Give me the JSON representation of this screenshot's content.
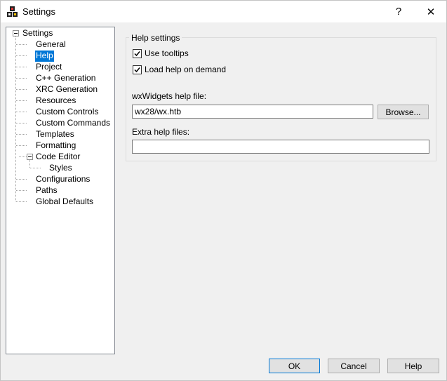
{
  "window": {
    "title": "Settings",
    "help_glyph": "?",
    "close_glyph": "✕"
  },
  "tree": {
    "items": [
      {
        "label": "Settings"
      },
      {
        "label": "General"
      },
      {
        "label": "Help",
        "selected": true
      },
      {
        "label": "Project"
      },
      {
        "label": "C++ Generation"
      },
      {
        "label": "XRC Generation"
      },
      {
        "label": "Resources"
      },
      {
        "label": "Custom Controls"
      },
      {
        "label": "Custom Commands"
      },
      {
        "label": "Templates"
      },
      {
        "label": "Formatting"
      },
      {
        "label": "Code Editor"
      },
      {
        "label": "Styles"
      },
      {
        "label": "Configurations"
      },
      {
        "label": "Paths"
      },
      {
        "label": "Global Defaults"
      }
    ]
  },
  "help_settings": {
    "group_label": "Help settings",
    "use_tooltips": {
      "label": "Use tooltips",
      "checked": true
    },
    "load_help_on_demand": {
      "label": "Load help on demand",
      "checked": true
    },
    "help_file_label": "wxWidgets help file:",
    "help_file_value": "wx28/wx.htb",
    "browse_label": "Browse...",
    "extra_files_label": "Extra help files:",
    "extra_files_value": ""
  },
  "footer": {
    "ok_label": "OK",
    "cancel_label": "Cancel",
    "help_label": "Help"
  }
}
